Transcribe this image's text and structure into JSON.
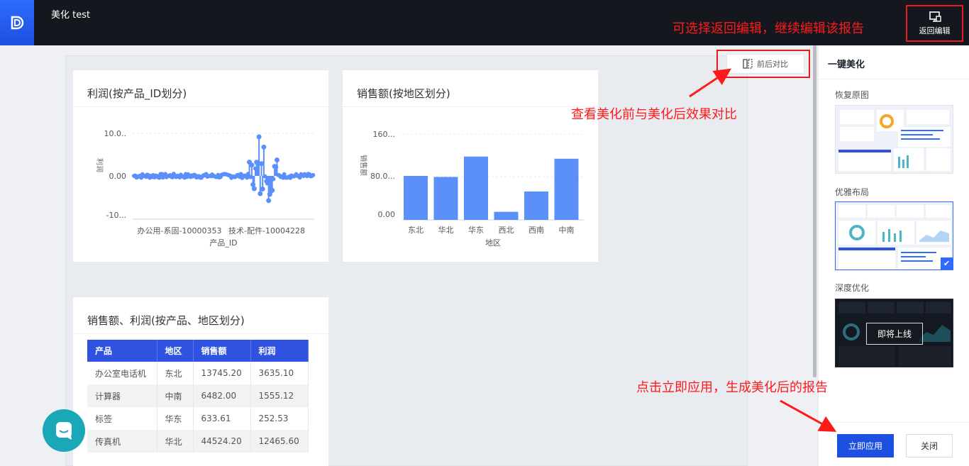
{
  "app": {
    "title": "美化 test"
  },
  "toolbar": {
    "back_label": "返回编辑"
  },
  "annotations": {
    "back_hint": "可选择返回编辑，继续编辑该报告",
    "compare_hint": "查看美化前与美化后效果对比",
    "apply_hint": "点击立即应用，生成美化后的报告"
  },
  "compare": {
    "label": "前后对比"
  },
  "cards": {
    "profit": {
      "title": "利润(按产品_ID划分)",
      "ylabel": "利润",
      "xlabel": "产品_ID",
      "yticks": [
        "10.0..",
        "0.00",
        "-10..."
      ],
      "xticks": [
        "办公用-系固-10000353",
        "技术-配件-10004228"
      ]
    },
    "sales": {
      "title": "销售额(按地区划分)",
      "ylabel": "销售额",
      "xlabel": "地区",
      "yticks": [
        "160...",
        "80.0...",
        "0.00"
      ]
    },
    "table": {
      "title": "销售额、利润(按产品、地区划分)",
      "columns": [
        "产品",
        "地区",
        "销售额",
        "利润"
      ],
      "rows": [
        [
          "办公室电话机",
          "东北",
          "13745.20",
          "3635.10"
        ],
        [
          "计算器",
          "中南",
          "6482.00",
          "1555.12"
        ],
        [
          "标签",
          "华东",
          "633.61",
          "252.53"
        ],
        [
          "传真机",
          "华北",
          "44524.20",
          "12465.60"
        ]
      ]
    }
  },
  "chart_data": [
    {
      "type": "bar",
      "title": "销售额(按地区划分)",
      "xlabel": "地区",
      "ylabel": "销售额",
      "categories": [
        "东北",
        "华北",
        "华东",
        "西北",
        "西南",
        "中南"
      ],
      "values": [
        82,
        80,
        118,
        15,
        53,
        114
      ],
      "ylim": [
        0,
        160
      ]
    },
    {
      "type": "scatter",
      "title": "利润(按产品_ID划分)",
      "xlabel": "产品_ID",
      "ylabel": "利润",
      "ylim": [
        -10,
        10
      ]
    }
  ],
  "panel": {
    "title": "一键美化",
    "sections": [
      "恢复原图",
      "优雅布局",
      "深度优化"
    ],
    "coming_soon": "即将上线",
    "apply_label": "立即应用",
    "close_label": "关闭"
  },
  "colors": {
    "accent": "#2f6bff",
    "bar": "#5b8ff9",
    "annotation": "#ff1a1a",
    "topbar": "#15171f"
  }
}
